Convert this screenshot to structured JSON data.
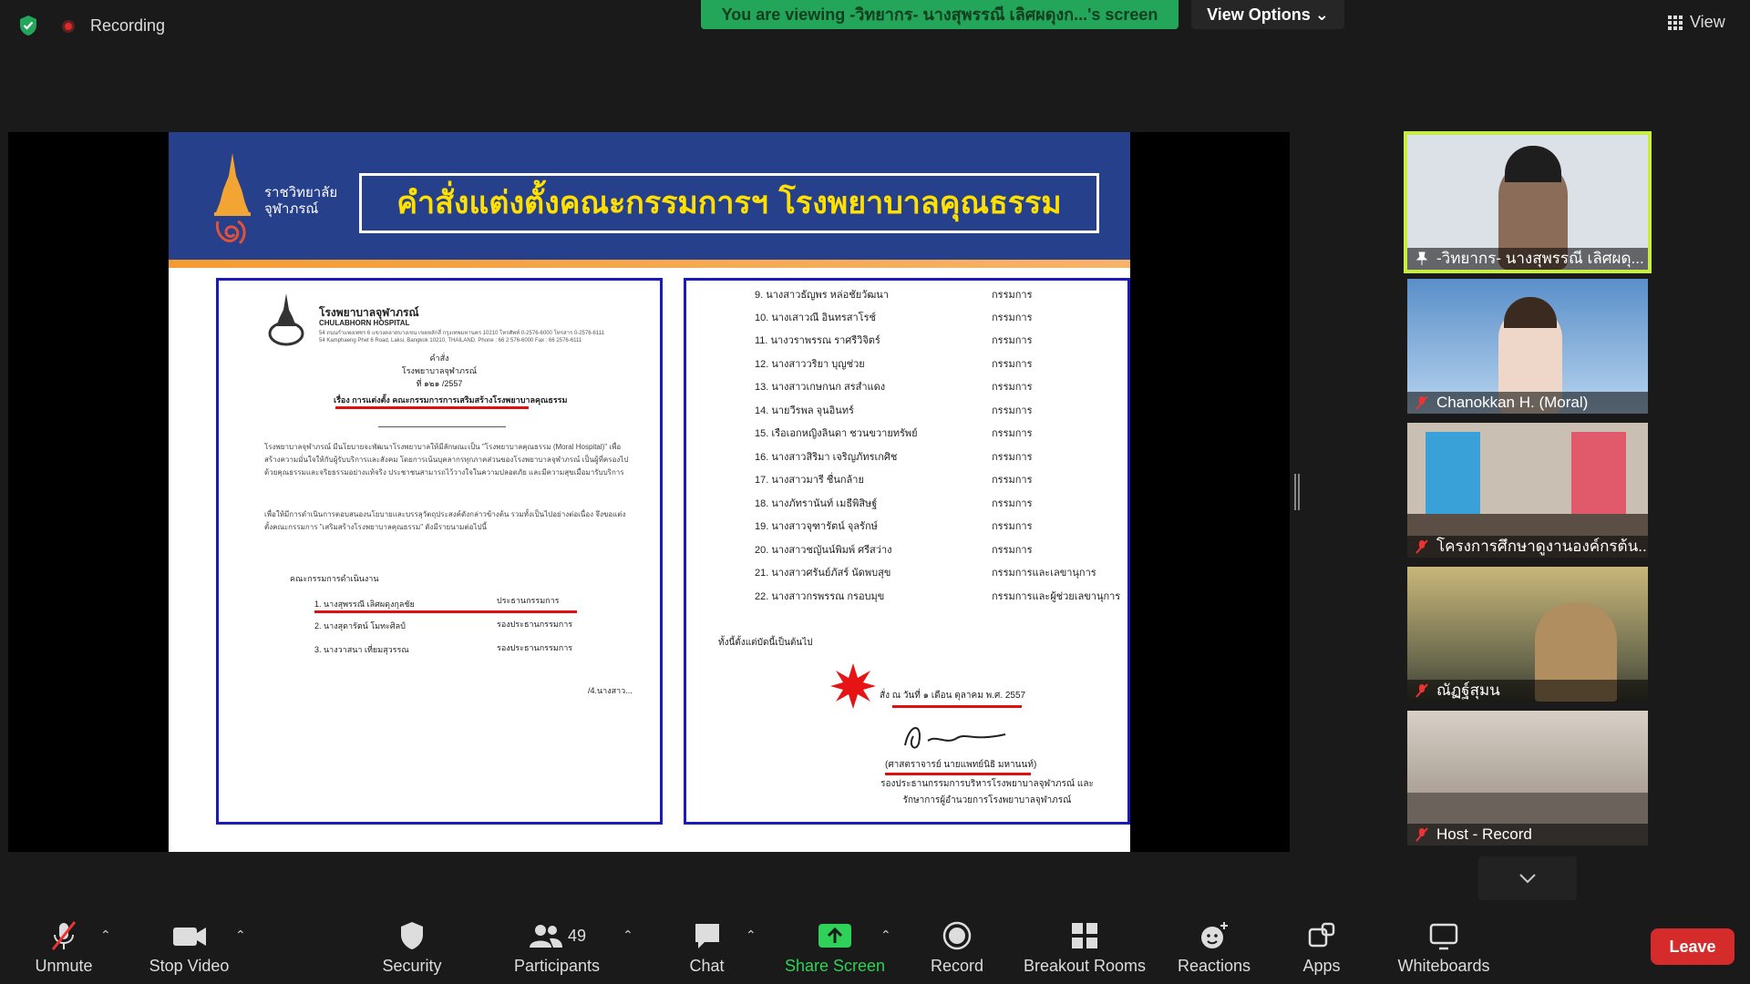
{
  "top_bar": {
    "recording_label": "Recording",
    "viewing_banner": "You are viewing -วิทยากร- นางสุพรรณี เลิศผดุงก...'s screen",
    "view_options_label": "View Options",
    "view_label": "View"
  },
  "slide": {
    "logo_line1": "ราชวิทยาลัย",
    "logo_line2": "จุฬาภรณ์",
    "title": "คำสั่งแต่งตั้งคณะกรรมการฯ โรงพยาบาลคุณธรรม"
  },
  "doc_left": {
    "hospital_name": "โรงพยาบาลจุฬาภรณ์",
    "hospital_en": "CHULABHORN HOSPITAL",
    "address_th": "54 ถนนกำแพงเพชร 6 แขวงตลาดบางเขน เขตหลักสี่ กรุงเทพมหานคร 10210 โทรศัพท์ 0-2576-6000 โทรสาร 0-2576-6111",
    "address_en": "54 Kamphaeng Phet 6 Road, Laksi, Bangkok 10210, THAILAND. Phone : 66 2 576-6000 Fax : 66 2576-6111",
    "order_word": "คำสั่ง",
    "order_org": "โรงพยาบาลจุฬาภรณ์",
    "order_no": "ที่   ๑๒๑ /2557",
    "subject": "เรื่อง  การแต่งตั้ง  คณะกรรมการการเสริมสร้างโรงพยาบาลคุณธรรม",
    "para1": "โรงพยาบาลจุฬาภรณ์ มีนโยบายจะพัฒนาโรงพยาบาลให้มีลักษณะเป็น \"โรงพยาบาลคุณธรรม (Moral Hospital)\" เพื่อสร้างความมั่นใจให้กับผู้รับบริการและสังคม โดยการเน้นบุคลากรทุกภาคส่วนของโรงพยาบาลจุฬาภรณ์ เป็นผู้ที่ครองไปด้วยคุณธรรมและจริยธรรมอย่างแท้จริง ประชาชนสามารถไว้วางใจในความปลอดภัย และมีความสุขเมื่อมารับบริการ",
    "para2": "เพื่อให้มีการดำเนินการตอบสนองนโยบายและบรรลุวัตถุประสงค์ดังกล่าวข้างต้น รวมทั้งเป็นไปอย่างต่อเนื่อง จึงขอแต่งตั้งคณะกรรมการ \"เสริมสร้างโรงพยาบาลคุณธรรม\" ดังมีรายนามต่อไปนี้",
    "committee_title": "คณะกรรมการดำเนินงาน",
    "members": [
      {
        "name": "1.  นางสุพรรณี  เลิศผดุงกุลชัย",
        "role": "ประธานกรรมการ"
      },
      {
        "name": "2.  นางสุดารัตน์  โมทะศิลป์",
        "role": "รองประธานกรรมการ"
      },
      {
        "name": "3.  นางวาสนา  เที่ยมสุวรรณ",
        "role": "รองประธานกรรมการ"
      }
    ],
    "continued": "/4.นางสาว..."
  },
  "doc_right": {
    "members": [
      {
        "name": "9.  นางสาวธัญพร  หล่อชัยวัฒนา",
        "role": "กรรมการ"
      },
      {
        "name": "10. นางเสาวณี  อินทรสาโรช์",
        "role": "กรรมการ"
      },
      {
        "name": "11. นางวราพรรณ  ราศรีวิจิตร์",
        "role": "กรรมการ"
      },
      {
        "name": "12. นางสาววริยา  บุญช่วย",
        "role": "กรรมการ"
      },
      {
        "name": "13. นางสาวเกษกนก  สรสำแดง",
        "role": "กรรมการ"
      },
      {
        "name": "14. นายวีรพล  จุนอินทร์",
        "role": "กรรมการ"
      },
      {
        "name": "15. เรือเอกหญิงลินดา  ชวนขวายทรัพย์",
        "role": "กรรมการ"
      },
      {
        "name": "16. นางสาวสิริมา  เจริญภัทรเกศิช",
        "role": "กรรมการ"
      },
      {
        "name": "17. นางสาวมารี  ชื่นกล้าย",
        "role": "กรรมการ"
      },
      {
        "name": "18. นางภัทรานันท์  เมธีพิสิษฐ์",
        "role": "กรรมการ"
      },
      {
        "name": "19. นางสาวจุฑารัตน์  จุลรักษ์",
        "role": "กรรมการ"
      },
      {
        "name": "20. นางสาวชญันน์พิมพ์  ศรีสว่าง",
        "role": "กรรมการ"
      },
      {
        "name": "21. นางสาวศรันย์ภัสร์  นัดพบสุข",
        "role": "กรรมการและเลขานุการ"
      },
      {
        "name": "22. นางสาวกรพรรณ  กรอบมุข",
        "role": "กรรมการและผู้ช่วยเลขานุการ"
      }
    ],
    "effective": "ทั้งนี้ตั้งแต่บัดนี้เป็นต้นไป",
    "date_line": "สั่ง  ณ  วันที่ ๑  เดือน ตุลาคม  พ.ศ.  2557",
    "signer_name": "(ศาสตราจารย์ นายแพทย์นิธิ  มหานนท์)",
    "signer_pos1": "รองประธานกรรมการบริหารโรงพยาบาลจุฬาภรณ์ และ",
    "signer_pos2": "รักษาการผู้อำนวยการโรงพยาบาลจุฬาภรณ์"
  },
  "participants": [
    {
      "name": "-วิทยากร- นางสุพรรณี เลิศผดุ...",
      "muted": false,
      "active": true,
      "bg": "#d7dde3"
    },
    {
      "name": "Chanokkan H. (Moral)",
      "muted": true,
      "active": false,
      "bg": "#a9c7e6"
    },
    {
      "name": "โครงการศึกษาดูงานองค์กรต้น...",
      "muted": true,
      "active": false,
      "bg": "#b9b2a8"
    },
    {
      "name": "ณัฏฐ์สุมน",
      "muted": true,
      "active": false,
      "bg": "#7d7a5e"
    },
    {
      "name": "Host - Record",
      "muted": true,
      "active": false,
      "bg": "#9a8f86"
    }
  ],
  "toolbar": {
    "unmute": "Unmute",
    "stop_video": "Stop Video",
    "security": "Security",
    "participants": "Participants",
    "participants_count": "49",
    "chat": "Chat",
    "share_screen": "Share Screen",
    "record": "Record",
    "breakout_rooms": "Breakout Rooms",
    "reactions": "Reactions",
    "apps": "Apps",
    "whiteboards": "Whiteboards",
    "leave": "Leave"
  },
  "colors": {
    "banner_green": "#23a55a",
    "slide_header_blue": "#27408b",
    "slide_title_yellow": "#ffe000",
    "active_speaker_border": "#c6ec45",
    "share_green": "#30d158",
    "leave_red": "#d62b2b"
  }
}
